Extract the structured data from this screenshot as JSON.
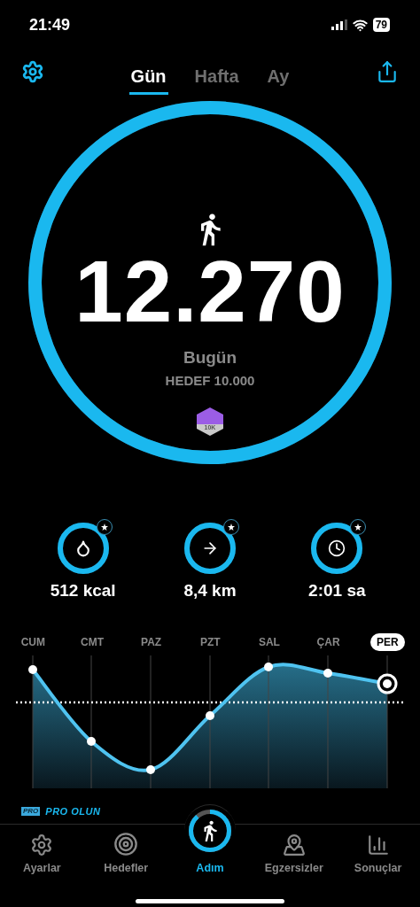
{
  "status_bar": {
    "time": "21:49",
    "battery": "79"
  },
  "tabs": [
    {
      "label": "Gün",
      "selected": true
    },
    {
      "label": "Hafta",
      "selected": false
    },
    {
      "label": "Ay",
      "selected": false
    }
  ],
  "steps": {
    "value": "12.270",
    "label": "Bugün",
    "goal": "HEDEF 10.000",
    "level": 1,
    "badge": "10K"
  },
  "stats": [
    {
      "kind": "calories",
      "value": "512 kcal",
      "level": 1
    },
    {
      "kind": "distance",
      "value": "8,4 km",
      "level": 1
    },
    {
      "kind": "time",
      "value": "2:01 sa",
      "level": 1
    }
  ],
  "week": {
    "days": [
      {
        "label": "CUM",
        "selected": false
      },
      {
        "label": "CMT",
        "selected": false
      },
      {
        "label": "PAZ",
        "selected": false
      },
      {
        "label": "PZT",
        "selected": false
      },
      {
        "label": "SAL",
        "selected": false
      },
      {
        "label": "ÇAR",
        "selected": false
      },
      {
        "label": "PER",
        "selected": true
      }
    ]
  },
  "promo": {
    "badge": "PRO",
    "text": "PRO OLUN"
  },
  "nav": [
    {
      "kind": "settings",
      "label": "Ayarlar",
      "selected": false
    },
    {
      "kind": "goals",
      "label": "Hedefler",
      "selected": false
    },
    {
      "kind": "steps",
      "label": "Adım",
      "selected": true,
      "level": 0.88
    },
    {
      "kind": "workouts",
      "label": "Egzersizler",
      "selected": false
    },
    {
      "kind": "results",
      "label": "Sonuçlar",
      "selected": false
    }
  ]
}
